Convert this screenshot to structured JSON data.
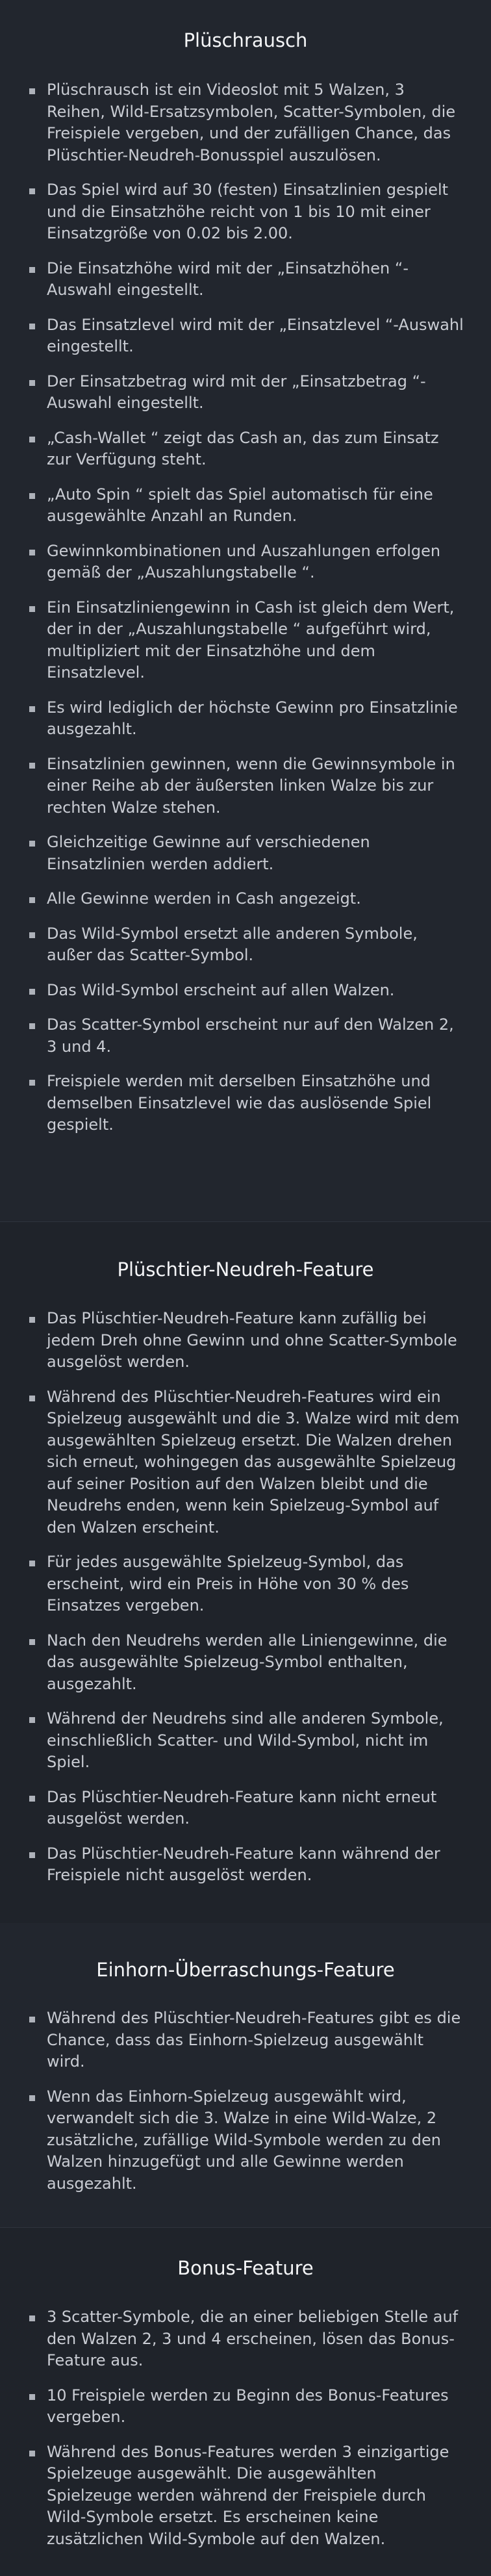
{
  "sections": [
    {
      "title": "Plüschrausch",
      "items": [
        "Plüschrausch ist ein Videoslot mit 5 Walzen, 3 Reihen, Wild-Ersatzsymbolen, Scatter-Symbolen, die Freispiele vergeben, und der zufälligen Chance, das Plüschtier-Neudreh-Bonusspiel auszulösen.",
        "Das Spiel wird auf 30 (festen) Einsatzlinien gespielt und die Einsatzhöhe reicht von 1 bis 10 mit einer Einsatzgröße von 0.02 bis 2.00.",
        "Die Einsatzhöhe wird mit der „Einsatzhöhen “-Auswahl eingestellt.",
        "Das Einsatzlevel wird mit der „Einsatzlevel “-Auswahl eingestellt.",
        "Der Einsatzbetrag wird mit der „Einsatzbetrag “-Auswahl eingestellt.",
        "„Cash-Wallet “ zeigt das Cash an, das zum Einsatz zur Verfügung steht.",
        "„Auto Spin “ spielt das Spiel automatisch für eine ausgewählte Anzahl an Runden.",
        "Gewinnkombinationen und Auszahlungen erfolgen gemäß der „Auszahlungstabelle “.",
        "Ein Einsatzliniengewinn in Cash ist gleich dem Wert, der in der „Auszahlungstabelle “ aufgeführt wird, multipliziert mit der Einsatzhöhe und dem Einsatzlevel.",
        "Es wird lediglich der höchste Gewinn pro Einsatzlinie ausgezahlt.",
        "Einsatzlinien gewinnen, wenn die Gewinnsymbole in einer Reihe ab der äußersten linken Walze bis zur rechten Walze stehen.",
        "Gleichzeitige Gewinne auf verschiedenen Einsatzlinien werden addiert.",
        "Alle Gewinne werden in Cash angezeigt.",
        "Das Wild-Symbol ersetzt alle anderen Symbole, außer das Scatter-Symbol.",
        "Das Wild-Symbol erscheint auf allen Walzen.",
        "Das Scatter-Symbol erscheint nur auf den Walzen 2, 3 und 4.",
        "Freispiele werden mit derselben Einsatzhöhe und demselben Einsatzlevel wie das auslösende Spiel gespielt."
      ]
    },
    {
      "title": "Plüschtier-Neudreh-Feature",
      "items": [
        "Das Plüschtier-Neudreh-Feature kann zufällig bei jedem Dreh ohne Gewinn und ohne Scatter-Symbole ausgelöst werden.",
        "Während des Plüschtier-Neudreh-Features wird ein Spielzeug ausgewählt und die 3. Walze wird mit dem ausgewählten Spielzeug ersetzt. Die Walzen drehen sich erneut, wohingegen das ausgewählte Spielzeug auf seiner Position auf den Walzen bleibt und die Neudrehs enden, wenn kein Spielzeug-Symbol auf den Walzen erscheint.",
        "Für jedes ausgewählte Spielzeug-Symbol, das erscheint, wird ein Preis in Höhe von 30 % des Einsatzes vergeben.",
        "Nach den Neudrehs werden alle Liniengewinne, die das ausgewählte Spielzeug-Symbol enthalten, ausgezahlt.",
        "Während der Neudrehs sind alle anderen Symbole, einschließlich Scatter- und Wild-Symbol, nicht im Spiel.",
        "Das Plüschtier-Neudreh-Feature kann nicht erneut ausgelöst werden.",
        "Das Plüschtier-Neudreh-Feature kann während der Freispiele nicht ausgelöst werden."
      ]
    },
    {
      "title": "Einhorn-Überraschungs-Feature",
      "items": [
        "Während des Plüschtier-Neudreh-Features gibt es die Chance, dass das Einhorn-Spielzeug ausgewählt wird.",
        "Wenn das Einhorn-Spielzeug ausgewählt wird, verwandelt sich die 3. Walze in eine Wild-Walze, 2 zusätzliche, zufällige Wild-Symbole werden zu den Walzen hinzugefügt und alle Gewinne werden ausgezahlt."
      ]
    },
    {
      "title": "Bonus-Feature",
      "items": [
        "3 Scatter-Symbole, die an einer beliebigen Stelle auf den Walzen 2, 3 und 4 erscheinen, lösen das Bonus-Feature aus.",
        "10 Freispiele werden zu Beginn des Bonus-Features vergeben.",
        "Während des Bonus-Features werden 3 einzigartige Spielzeuge ausgewählt. Die ausgewählten Spielzeuge werden während der Freispiele durch Wild-Symbole ersetzt. Es erscheinen keine zusätzlichen Wild-Symbole auf den Walzen."
      ]
    }
  ]
}
